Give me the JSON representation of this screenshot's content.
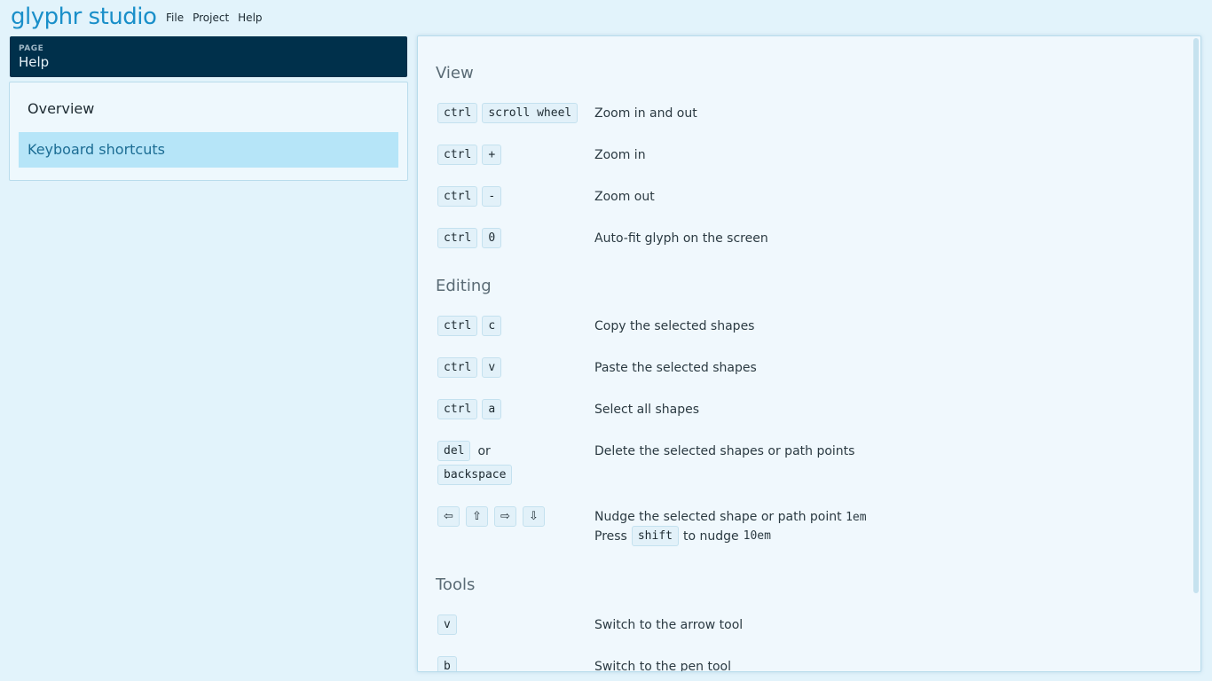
{
  "app": {
    "logo": "glyphr studio"
  },
  "menu": {
    "file": "File",
    "project": "Project",
    "help": "Help"
  },
  "page_header": {
    "label": "PAGE",
    "title": "Help"
  },
  "nav": {
    "items": [
      {
        "label": "Overview"
      },
      {
        "label": "Keyboard shortcuts"
      }
    ]
  },
  "sections": {
    "view": {
      "title": "View",
      "rows": [
        {
          "keys": [
            "ctrl",
            "scroll wheel"
          ],
          "desc": "Zoom in and out"
        },
        {
          "keys": [
            "ctrl",
            "+"
          ],
          "desc": "Zoom in"
        },
        {
          "keys": [
            "ctrl",
            "-"
          ],
          "desc": "Zoom out"
        },
        {
          "keys": [
            "ctrl",
            "0"
          ],
          "desc": "Auto-fit glyph on the screen"
        }
      ]
    },
    "editing": {
      "title": "Editing",
      "rows": [
        {
          "keys": [
            "ctrl",
            "c"
          ],
          "desc": "Copy the selected shapes"
        },
        {
          "keys": [
            "ctrl",
            "v"
          ],
          "desc": "Paste the selected shapes"
        },
        {
          "keys": [
            "ctrl",
            "a"
          ],
          "desc": "Select all shapes"
        },
        {
          "keys": [
            "del",
            "backspace"
          ],
          "or": "or",
          "desc": "Delete the selected shapes or path points"
        },
        {
          "keys": [
            "⇦",
            "⇧",
            "⇨",
            "⇩"
          ],
          "desc": "Nudge the selected shape or path point",
          "desc_unit": "1em",
          "desc2_prefix": "Press",
          "desc2_key": "shift",
          "desc2_suffix": "to nudge",
          "desc2_unit": "10em"
        }
      ]
    },
    "tools": {
      "title": "Tools",
      "rows": [
        {
          "keys": [
            "v"
          ],
          "desc": "Switch to the arrow tool"
        },
        {
          "keys": [
            "b"
          ],
          "desc": "Switch to the pen tool"
        }
      ]
    }
  }
}
